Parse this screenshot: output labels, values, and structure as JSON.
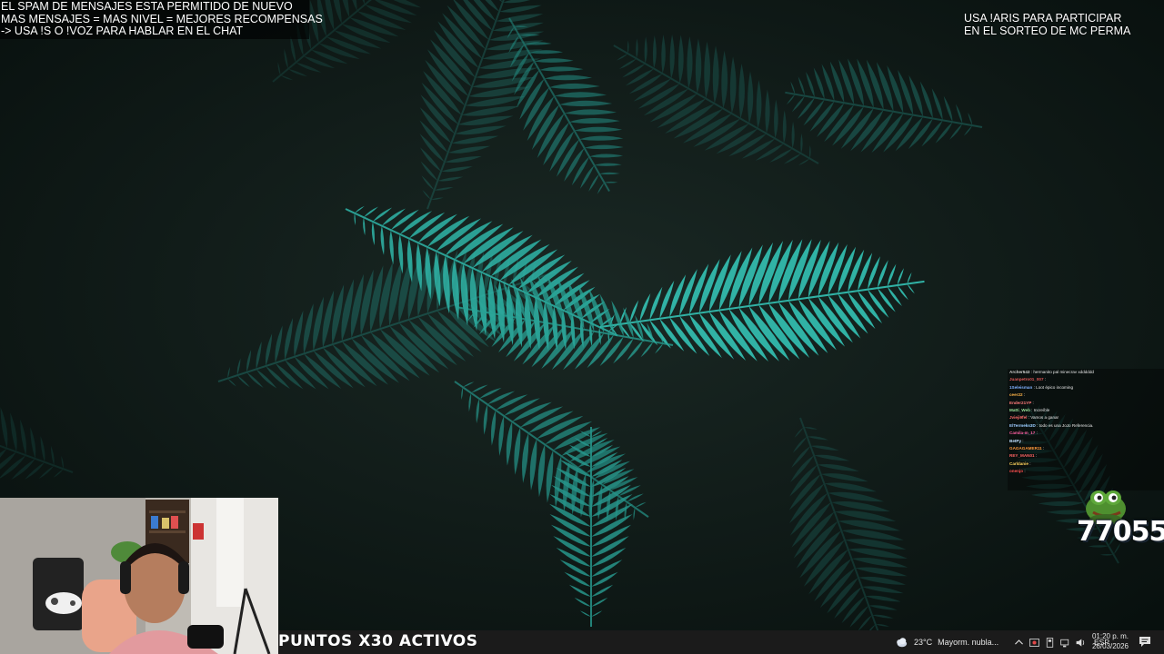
{
  "announcement": {
    "lines": [
      "EL SPAM DE MENSAJES ESTA PERMITIDO DE NUEVO",
      "MAS MENSAJES = MAS NIVEL = MEJORES RECOMPENSAS",
      "-> USA !S  O !VOZ PARA HABLAR EN EL CHAT"
    ]
  },
  "giveaway": {
    "lines": [
      "USA !ARIS PARA PARTICIPAR",
      "EN EL SORTEO DE MC PERMA"
    ]
  },
  "chat": {
    "messages": [
      {
        "user": "Archer543",
        "text": "hermanito pal minecrav xdddddd",
        "color": "#d0d0d0"
      },
      {
        "user": "Juanpetro01_007",
        "text": "",
        "color": "#e05656"
      },
      {
        "user": "1Seleisman",
        "text": "Loot épico incoming",
        "color": "#7fb0ff"
      },
      {
        "user": "ceer22",
        "text": "",
        "color": "#ffb347"
      },
      {
        "user": "Ender21YP",
        "text": "",
        "color": "#ff7b7b"
      },
      {
        "user": "Matti_Web",
        "text": "Increíble",
        "color": "#9be39b"
      },
      {
        "user": "Jvieji9fel",
        "text": "Vamos a ganar",
        "color": "#ff6b6b"
      },
      {
        "user": "ElTermeks3D",
        "text": "todo es una JoJo Referencia.",
        "color": "#9ecbff"
      },
      {
        "user": "Camila-m_17",
        "text": "",
        "color": "#ff5fa2"
      },
      {
        "user": "BetPy",
        "text": "",
        "color": "#c0e0ff"
      },
      {
        "user": "GAGAGAMER11",
        "text": "",
        "color": "#ff9a3c"
      },
      {
        "user": "REY_MAN01",
        "text": "",
        "color": "#ff6464"
      },
      {
        "user": "Carldanie",
        "text": "",
        "color": "#ffd45e"
      },
      {
        "user": "onenjo",
        "text": "",
        "color": "#ff4f4f"
      }
    ]
  },
  "counter": {
    "value": "77055",
    "icon": "pepe-frog-icon"
  },
  "banner": {
    "text": "PUNTOS X30 ACTIVOS"
  },
  "taskbar": {
    "weather": {
      "temp": "23°C",
      "desc": "Mayorm. nubla..."
    },
    "language": "ESP",
    "time": "01:20 p. m.",
    "date": "26/03/2026"
  }
}
